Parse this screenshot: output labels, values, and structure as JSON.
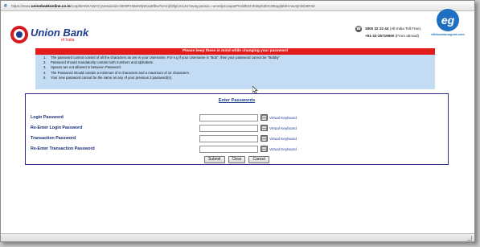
{
  "browser": {
    "url_prefix": "https://www.",
    "url_domain": "unionbankonline.co.in",
    "url_rest": "/corp/BANKAWAY;jsessionid=0000PHMeN5jWouBfbw75A/njl/3fgicm13o7avay.param=-umedpCuopwPH3dB2zVkMp/kdDC0Bqq/j9i6HA&vQmkD6RsZ"
  },
  "header": {
    "brand_name": "Union Bank",
    "brand_sub": "of India",
    "tollfree_number": "1800 22 22 44",
    "tollfree_note": "(All-India Toll Free)",
    "abroad_number": "+91-22-25719600",
    "abroad_note": "(From abroad)",
    "watermark_text": "eEducationsgnet.com"
  },
  "notice": {
    "heading": "Please keep these in mind while changing your password",
    "items": [
      {
        "num": "1.",
        "text": "The password cannot consist of all the characters as are in your Username. For e.g if your Username is \"Bob\", then your password cannot be \"Bobby\""
      },
      {
        "num": "2.",
        "text": "Password should mandatorily contain both numbers and alphabets ."
      },
      {
        "num": "3.",
        "text": "Spaces are not allowed in between Password."
      },
      {
        "num": "4.",
        "text": "The Password should contain a minimum of 6 characters and a maximum of 14 characters ."
      },
      {
        "num": "5.",
        "text": "Your new password cannot be the same as any of your previous 3 password(s)."
      }
    ]
  },
  "form": {
    "title": "Enter Passwords",
    "fields": [
      {
        "label": "Login Password",
        "value": "",
        "keyboard_label": "Virtual Keyboard"
      },
      {
        "label": "Re-Enter Login Password",
        "value": "",
        "keyboard_label": "Virtual Keyboard"
      },
      {
        "label": "Transaction Password",
        "value": "",
        "keyboard_label": "Virtual Keyboard"
      },
      {
        "label": "Re-Enter Transaction Password",
        "value": "",
        "keyboard_label": "Virtual Keyboard"
      }
    ],
    "submit_label": "Submit",
    "clear_label": "Clear",
    "cancel_label": "Cancel"
  },
  "colors": {
    "brand_blue": "#1b3d8f",
    "brand_red": "#d71920",
    "notice_bg": "#c3dcf4",
    "notice_header": "#e31b1b"
  }
}
